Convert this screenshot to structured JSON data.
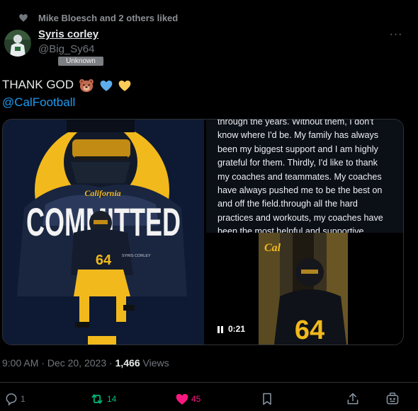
{
  "social_context": {
    "text": "Mike Bloesch and 2 others liked"
  },
  "author": {
    "display_name": "Syris corley",
    "handle": "@Big_Sy64",
    "badge": "Unknown"
  },
  "more_icon": "more-icon",
  "tweet": {
    "text": "THANK GOD",
    "emojis": [
      "bear-face",
      "blue-heart",
      "yellow-heart"
    ],
    "mention": "@CalFootball"
  },
  "media": {
    "graphic": {
      "headline": "COMMITTED",
      "brand": "California",
      "player_name": "SYRIS CORLEY",
      "jersey_number": "64"
    },
    "statement_lines": [
      "through the years. Without them, I don't",
      "know where I'd be. My family has always",
      "been my biggest support and I am highly",
      "grateful for them. Thirdly, I'd like to thank",
      "my coaches and teammates. My coaches",
      "have always pushed me to be the best on",
      "and off the field.through all the hard",
      "practices and workouts, my coaches have",
      "been the most helpful and supportive"
    ],
    "video": {
      "duration": "0:21",
      "jersey_number": "64",
      "brand": "Cal"
    }
  },
  "meta": {
    "time": "9:00 AM",
    "separator": "·",
    "date": "Dec 20, 2023",
    "views_count": "1,466",
    "views_label": "Views"
  },
  "actions": {
    "reply": {
      "count": "1",
      "icon": "reply-icon"
    },
    "retweet": {
      "count": "14",
      "icon": "retweet-icon"
    },
    "like": {
      "count": "45",
      "icon": "like-icon"
    },
    "bookmark": {
      "icon": "bookmark-icon"
    },
    "share": {
      "icon": "share-icon"
    },
    "grok": {
      "icon": "grok-icon"
    }
  },
  "colors": {
    "background": "#000000",
    "text_primary": "#e7e9ea",
    "text_secondary": "#71767b",
    "link": "#1d9bf0",
    "retweet": "#00ba7c",
    "like": "#f91880",
    "cal_gold": "#f2b91c",
    "cal_navy": "#0e1a33"
  }
}
